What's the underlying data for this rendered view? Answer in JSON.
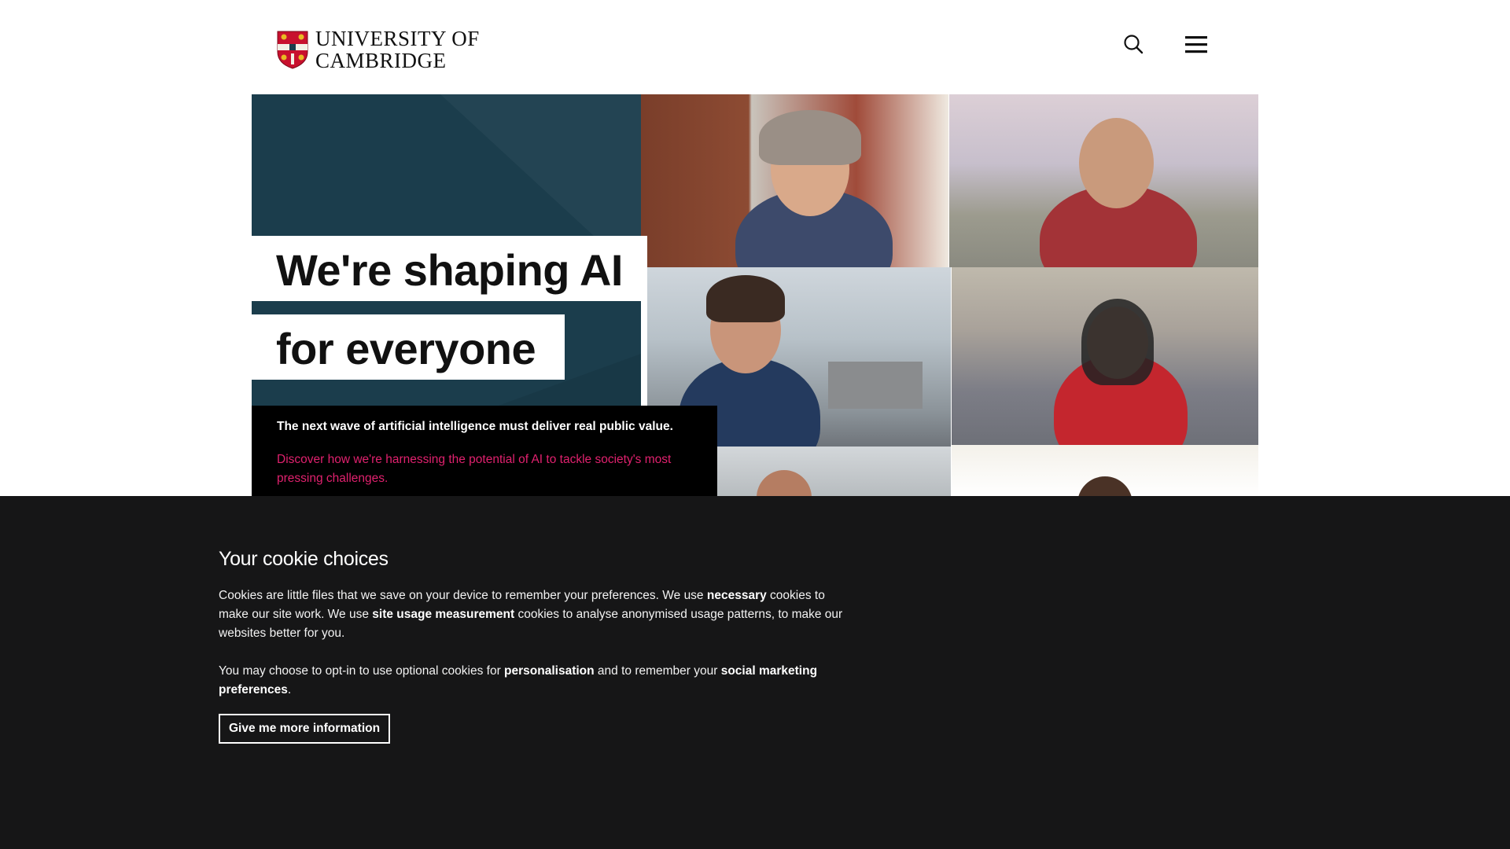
{
  "header": {
    "logo_line1": "UNIVERSITY OF",
    "logo_line2": "CAMBRIDGE",
    "icons": [
      "search-icon",
      "hamburger-menu-icon"
    ]
  },
  "hero": {
    "headline_line1": "We're shaping AI",
    "headline_line2": "for everyone",
    "subtitle": "The next wave of artificial intelligence must deliver real public value.",
    "link_text": "Discover how we're harnessing the potential of AI to tackle society's most pressing challenges.",
    "colors": {
      "panel": "#1b3d4c",
      "link": "#e0216e"
    }
  },
  "cookie_banner": {
    "title": "Your cookie choices",
    "para1": {
      "t1": "Cookies are little files that we save on your device to remember your preferences. We use ",
      "b1": "necessary",
      "t2": " cookies to make our site work. We use ",
      "b2": "site usage measurement",
      "t3": " cookies to analyse anonymised usage patterns, to make our websites better for you."
    },
    "para2": {
      "t1": "You may choose to opt-in to use optional cookies for ",
      "b1": "personalisation",
      "t2": " and to remember your ",
      "b2": "social marketing preferences",
      "t3": "."
    },
    "button_label": "Give me more information",
    "background": "#161617"
  }
}
